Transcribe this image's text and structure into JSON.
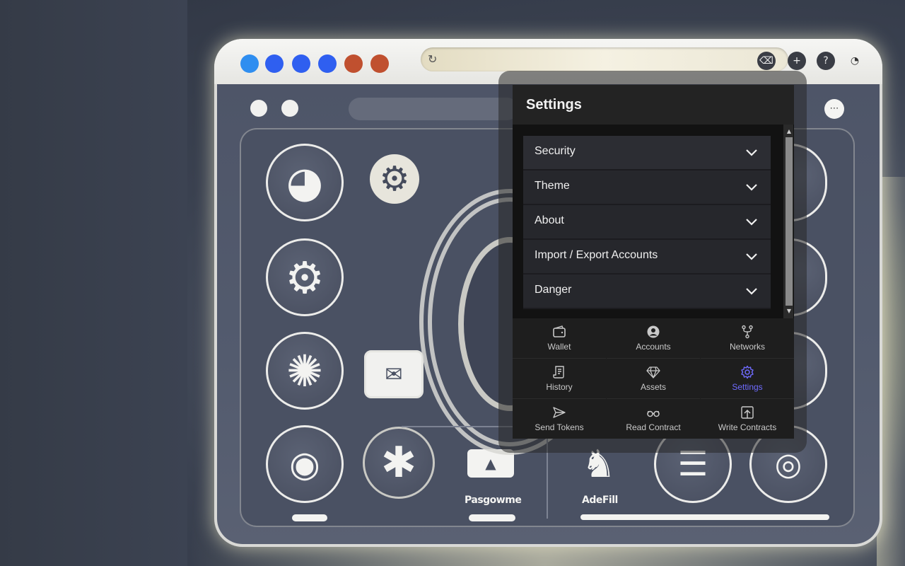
{
  "settings": {
    "title": "Settings",
    "sections": [
      {
        "label": "Security"
      },
      {
        "label": "Theme"
      },
      {
        "label": "About"
      },
      {
        "label": "Import / Export Accounts"
      },
      {
        "label": "Danger"
      }
    ]
  },
  "nav": {
    "items": [
      {
        "label": "Wallet",
        "icon": "wallet-icon"
      },
      {
        "label": "Accounts",
        "icon": "account-icon"
      },
      {
        "label": "Networks",
        "icon": "network-icon"
      },
      {
        "label": "History",
        "icon": "history-icon"
      },
      {
        "label": "Assets",
        "icon": "diamond-icon"
      },
      {
        "label": "Settings",
        "icon": "gear-icon",
        "active": true
      },
      {
        "label": "Send Tokens",
        "icon": "send-icon"
      },
      {
        "label": "Read Contract",
        "icon": "glasses-icon"
      },
      {
        "label": "Write Contracts",
        "icon": "upload-icon"
      }
    ]
  },
  "illustration": {
    "label_left": "Pasgowme",
    "label_right": "AdeFill"
  },
  "colors": {
    "accent": "#6f6bff",
    "panel_bg": "#1a1a1a",
    "item_bg": "#26272c"
  }
}
